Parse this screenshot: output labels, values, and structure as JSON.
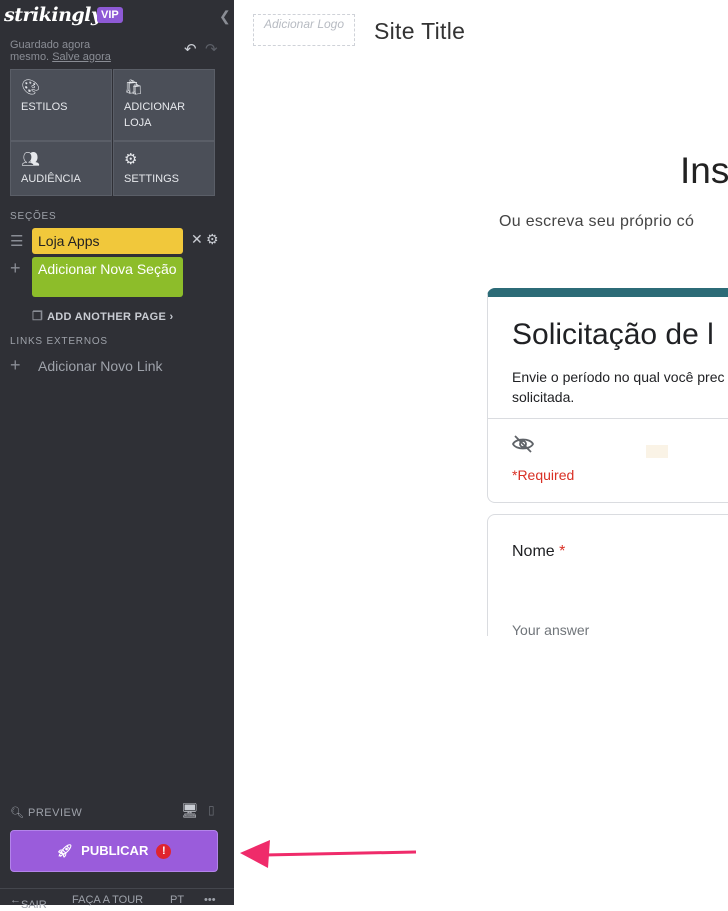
{
  "sidebar": {
    "brand": "strikingly",
    "badge": "VIP",
    "status_line1": "Guardado agora",
    "status_line2": "mesmo.",
    "save_link": "Salve agora",
    "tiles": [
      {
        "label": "ESTILOS",
        "icon": "palette-icon"
      },
      {
        "label": "ADICIONAR LOJA",
        "icon": "store-bag-icon"
      },
      {
        "label": "AUDIÊNCIA",
        "icon": "audience-icon"
      },
      {
        "label": "SETTINGS",
        "icon": "gear-icon"
      }
    ],
    "sections_label": "SEÇÕES",
    "sections": [
      {
        "label": "Loja Apps",
        "color": "#f1c83b"
      },
      {
        "label": "Adicionar Nova Seção",
        "color": "#8dbd2a"
      }
    ],
    "add_page": "ADD ANOTHER PAGE",
    "external_links_label": "LINKS EXTERNOS",
    "add_link": "Adicionar Novo Link",
    "preview": "PREVIEW",
    "publish": "PUBLICAR",
    "footer": {
      "exit": "SAIR",
      "tour": "FAÇA A TOUR",
      "lang": "PT",
      "more": "•••"
    }
  },
  "canvas": {
    "logo_placeholder": "Adicionar Logo",
    "site_title": "Site Title",
    "heading_fragment": "Ins",
    "subheading_fragment": "Ou escreva seu próprio có",
    "form": {
      "title": "Solicitação de l",
      "description": "Envie o período no qual você prec solicitada.",
      "required": "*Required",
      "field_label": "Nome",
      "required_star": "*",
      "answer_placeholder": "Your answer",
      "accent": "#2c6b77"
    }
  },
  "colors": {
    "sidebar": "#2f3036",
    "publish": "#9a5cdb",
    "arrow": "#ef2b6a"
  }
}
